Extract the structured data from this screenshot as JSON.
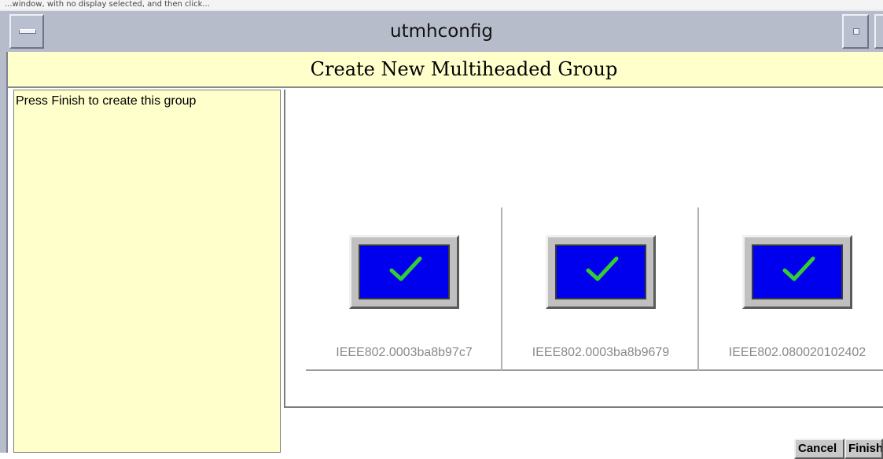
{
  "window": {
    "title": "utmhconfig"
  },
  "top_caption": "...window, with no display selected, and then click...",
  "wizard": {
    "page_title": "Create New Multiheaded Group",
    "instruction": "Press Finish to create this group"
  },
  "displays": [
    {
      "label": "IEEE802.0003ba8b97c7",
      "status_icon": "checkmark-icon"
    },
    {
      "label": "IEEE802.0003ba8b9679",
      "status_icon": "checkmark-icon"
    },
    {
      "label": "IEEE802.080020102402",
      "status_icon": "checkmark-icon"
    }
  ],
  "buttons": {
    "cancel": "Cancel",
    "finish": "Finish"
  },
  "colors": {
    "instruction_bg": "#ffffcc",
    "screen_fill": "#0000ee",
    "check": "#33cc33"
  }
}
